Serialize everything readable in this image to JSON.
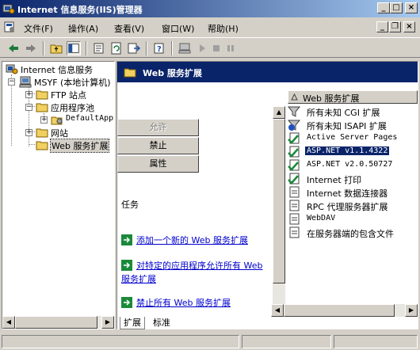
{
  "window": {
    "title": "Internet 信息服务(IIS)管理器",
    "minimize_glyph": "_",
    "maximize_glyph": "□",
    "close_glyph": "×"
  },
  "menu": {
    "items": [
      "文件(F)",
      "操作(A)",
      "查看(V)",
      "窗口(W)",
      "帮助(H)"
    ],
    "mdi_minimize": "_",
    "mdi_restore": "❐",
    "mdi_close": "×"
  },
  "toolbar": {
    "buttons": [
      "back-arrow-icon",
      "forward-arrow-icon",
      "up-folder-icon",
      "show-tree-icon",
      "properties-icon",
      "refresh-icon",
      "export-list-icon",
      "help-icon",
      "computer-icon",
      "play-icon",
      "stop-icon",
      "pause-icon"
    ]
  },
  "tree": {
    "root": "Internet 信息服务",
    "computer": "MSYF (本地计算机)",
    "ftp": "FTP 站点",
    "app_pools": "应用程序池",
    "default_pool": "DefaultAppPool",
    "websites": "网站",
    "web_ext": "Web 服务扩展"
  },
  "right_pane": {
    "header_title": "Web 服务扩展",
    "buttons": {
      "allow": "允许",
      "prohibit": "禁止",
      "properties": "属性"
    },
    "tasks_title": "任务",
    "tasks": [
      "添加一个新的 Web 服务扩展",
      "对特定的应用程序允许所有 Web 服务扩展",
      "禁止所有 Web 服务扩展"
    ],
    "list_header": "Web 服务扩展",
    "list_items": [
      {
        "label": "所有未知 CGI 扩展",
        "icon": "filter-icon",
        "selected": false
      },
      {
        "label": "所有未知 ISAPI 扩展",
        "icon": "blocked-extension-icon",
        "selected": false
      },
      {
        "label": "Active Server Pages",
        "icon": "allowed-extension-icon",
        "selected": false
      },
      {
        "label": "ASP.NET v1.1.4322",
        "icon": "allowed-extension-icon",
        "selected": true
      },
      {
        "label": "ASP.NET v2.0.50727",
        "icon": "allowed-extension-icon",
        "selected": false
      },
      {
        "label": "Internet 打印",
        "icon": "allowed-extension-icon",
        "selected": false
      },
      {
        "label": "Internet 数据连接器",
        "icon": "prohibited-extension-icon",
        "selected": false
      },
      {
        "label": "RPC 代理服务器扩展",
        "icon": "prohibited-extension-icon",
        "selected": false
      },
      {
        "label": "WebDAV",
        "icon": "prohibited-extension-icon",
        "selected": false
      },
      {
        "label": "在服务器端的包含文件",
        "icon": "prohibited-extension-icon",
        "selected": false
      }
    ]
  },
  "tabs": {
    "extended": "扩展",
    "standard": "标准"
  },
  "colors": {
    "title_start": "#0a246a",
    "title_end": "#a6caf0",
    "face": "#d4d0c8",
    "link": "#0000cc",
    "selection": "#0a246a"
  }
}
